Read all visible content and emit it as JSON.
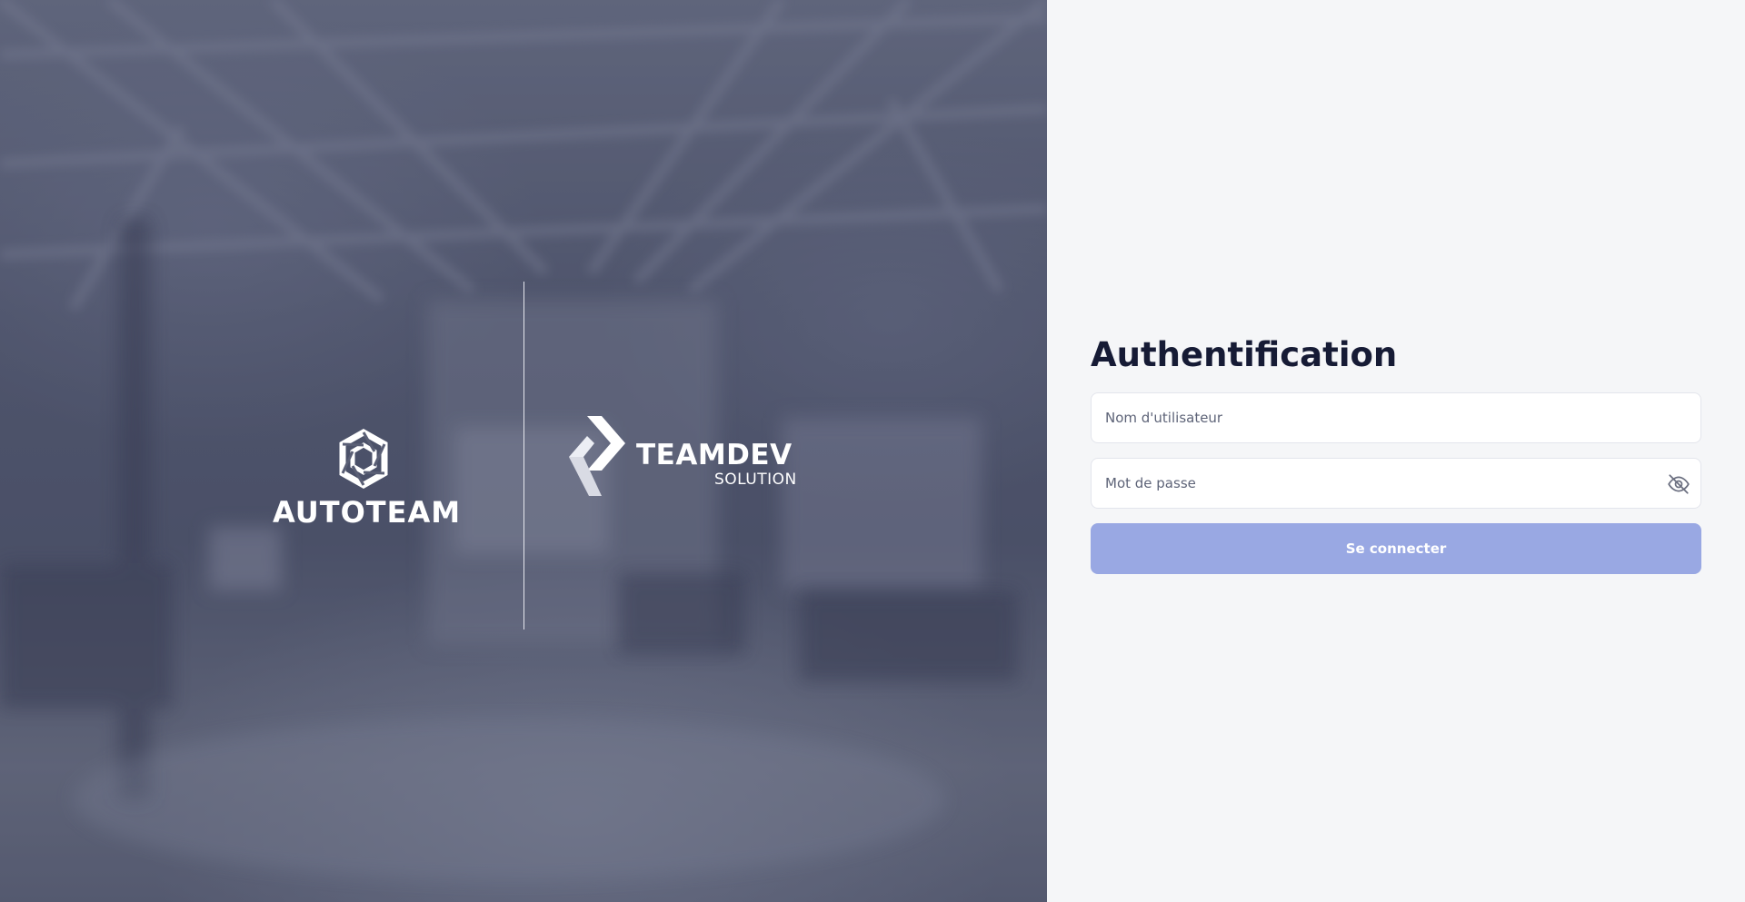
{
  "hero": {
    "brand_left": {
      "icon": "autoteam-logo-mark",
      "name": "AUTOTEAM"
    },
    "brand_right": {
      "icon": "teamdev-logo-mark",
      "name": "TEAMDEV",
      "subtitle": "SOLUTION"
    }
  },
  "login": {
    "title": "Authentification",
    "username": {
      "value": "",
      "placeholder": "Nom d'utilisateur"
    },
    "password": {
      "value": "",
      "placeholder": "Mot de passe",
      "toggle_icon": "eye-slash-icon"
    },
    "submit_label": "Se connecter"
  },
  "colors": {
    "title": "#161b35",
    "button": "#99a8e3",
    "panel_bg": "#f5f6f8"
  }
}
